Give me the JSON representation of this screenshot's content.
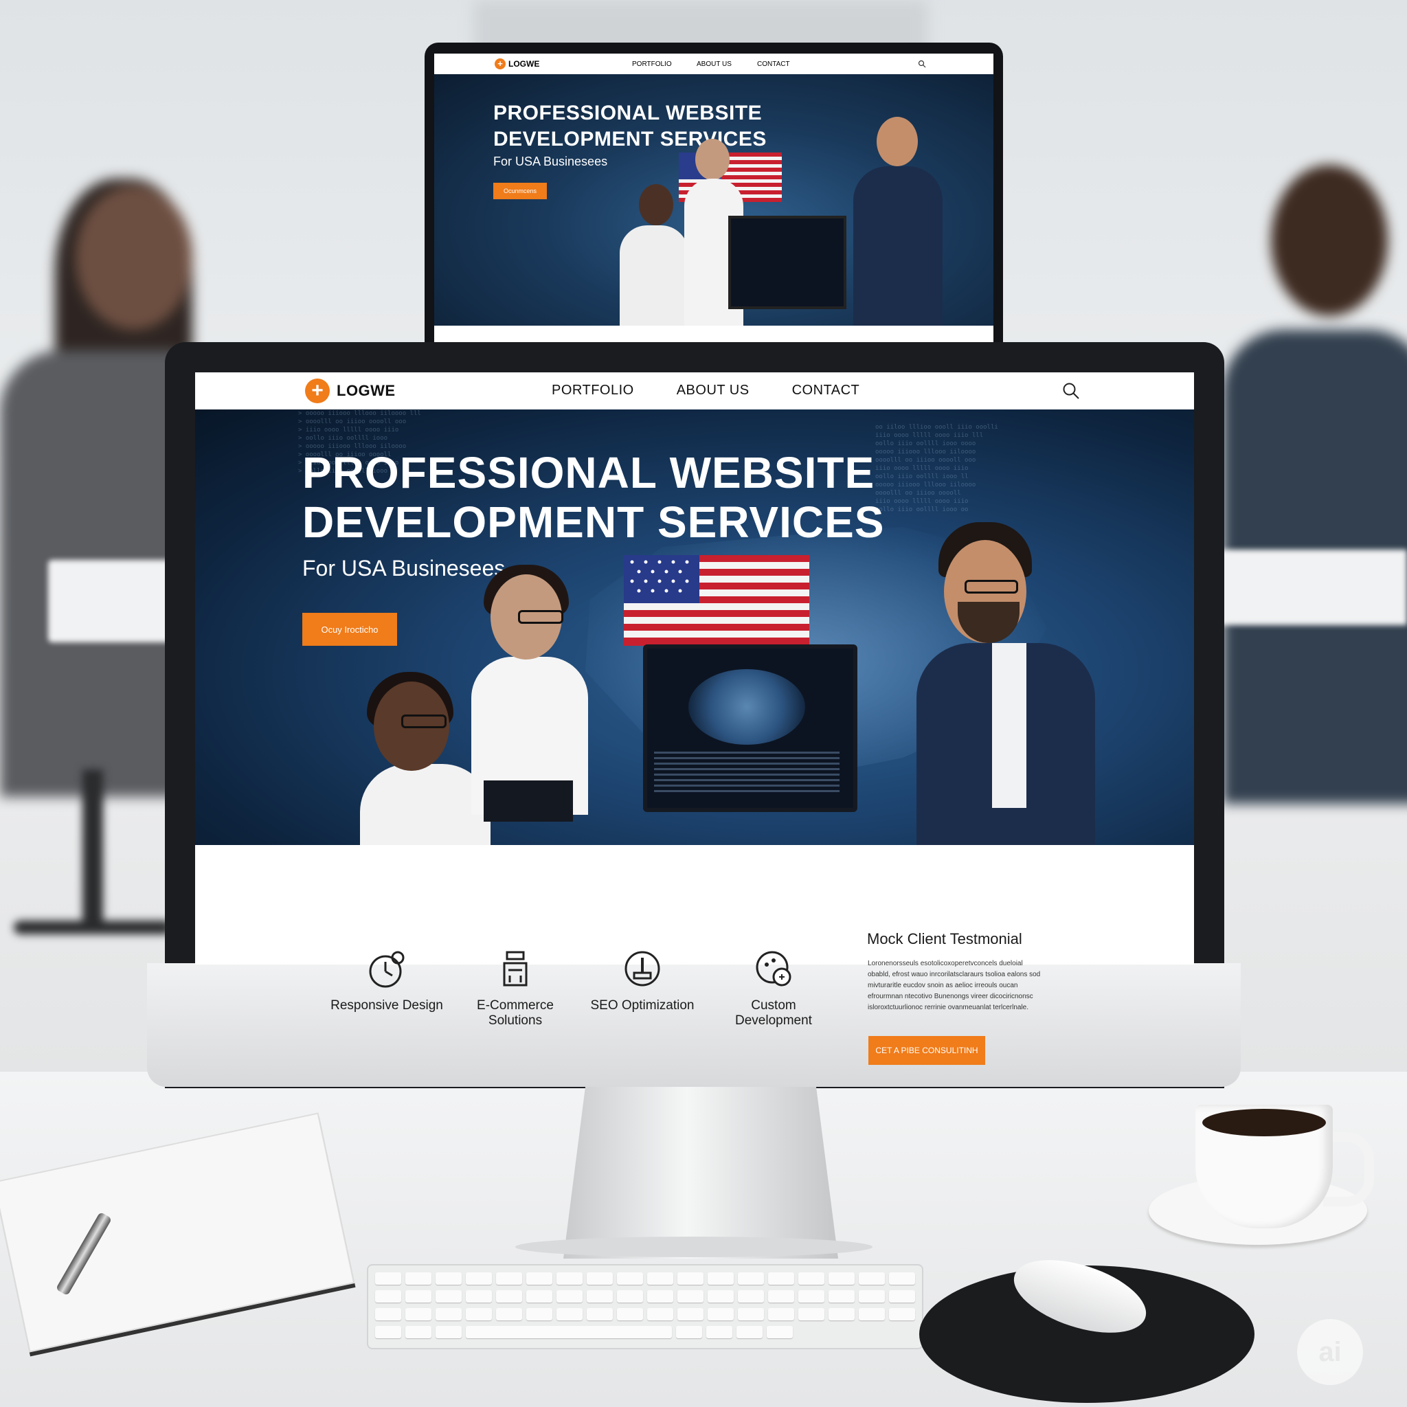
{
  "site": {
    "logo_text": "LOGWE",
    "nav": [
      "PORTFOLIO",
      "ABOUT US",
      "CONTACT"
    ],
    "hero": {
      "title_line1": "PROFESSIONAL WEBSITE",
      "title_line2": "DEVELOPMENT SERVICES",
      "subtitle": "For USA Businesees",
      "cta_label": "Ocuy Irocticho"
    },
    "services": [
      {
        "label_line1": "Responsive Design",
        "label_line2": "",
        "icon": "stopwatch-icon"
      },
      {
        "label_line1": "E-Commerce",
        "label_line2": "Solutions",
        "icon": "store-icon"
      },
      {
        "label_line1": "SEO Optimization",
        "label_line2": "",
        "icon": "seo-icon"
      },
      {
        "label_line1": "Custom Development",
        "label_line2": "",
        "icon": "custom-dev-icon"
      }
    ],
    "testimonial": {
      "title": "Mock Client Testmonial",
      "body": "Loronenorsseuls esotolicoxoperetvconcels dueloial obabld, efrost wauo inrcorilatsclaraurs tsolioa ealons sod mivturaritle eucdov snoin as aelioc irreouls oucan efrourmnan ntecotivo Bunenongs vireer dicociricnonsc isloroxtctuurlionoc rerrinie ovanmeuanlat terlcerlnale.",
      "cta_label": "CET A PIBE CONSULITINH"
    }
  },
  "back_site": {
    "logo_text": "LOGWE",
    "nav": [
      "PORTFOLIO",
      "ABOUT US",
      "CONTACT"
    ],
    "title_line1": "PROFESSIONAL WEBSITE",
    "title_line2": "DEVELOPMENT SERVICES",
    "subtitle": "For USA Businesees",
    "cta_label": "Ocunmcens"
  },
  "watermark": "ai",
  "colors": {
    "accent": "#f07c1a",
    "hero_dark": "#0e2540",
    "hero_light": "#2f6294"
  }
}
